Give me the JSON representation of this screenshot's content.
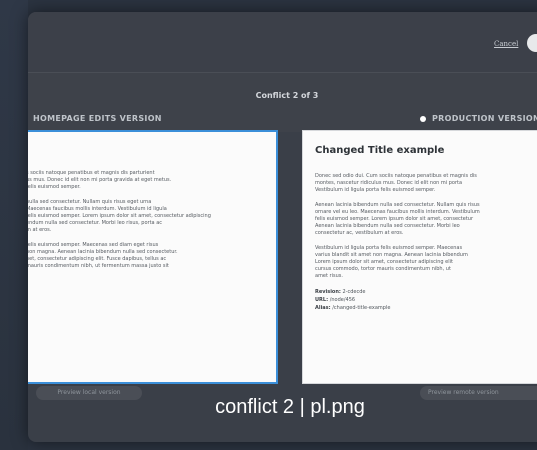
{
  "dialog": {
    "cancel_label": "Cancel",
    "conflict_count": "Conflict 2 of 3"
  },
  "left_version": {
    "title": "HOMEPAGE EDITS VERSION",
    "paragraphs": [
      "s sociis natoque penatibus et magnis dis parturient\nus mus. Donec id elit non mi porta gravida at eget metus.\nfelis euismod semper.",
      "nulla sed consectetur. Nullam quis risus eget urna\nMaecenas faucibus mollis interdum. Vestibulum id ligula\nfelis euismod semper. Lorem ipsum dolor sit amet, consectetur adipiscing\nendum nulla sed consectetur. Morbi leo risus, porta ac\nm at eros.",
      "felis euismod semper. Maecenas sed diam eget risus\nnon magna. Aenean lacinia bibendum nulla sed consectetur.\nnet, consectetur adipiscing elit. Fusce dapibus, tellus ac\nmauris condimentum nibh, ut fermentum massa justo sit"
    ],
    "preview_label": "Preview local version"
  },
  "right_version": {
    "title": "PRODUCTION VERSION",
    "heading": "Changed Title example",
    "paragraphs": [
      "Donec sed odio dui. Cum sociis natoque penatibus et magnis dis\nmontes, nascetur ridiculus mus. Donec id elit non mi porta\nVestibulum id ligula porta felis euismod semper.",
      "Aenean lacinia bibendum nulla sed consectetur. Nullam quis risus\nornare vel eu leo. Maecenas faucibus mollis interdum. Vestibulum\nfelis euismod semper. Lorem ipsum dolor sit amet, consectetur\nAenean lacinia bibendum nulla sed consectetur. Morbi leo\nconsectetur ac, vestibulum at eros.",
      "Vestibulum id ligula porta felis euismod semper. Maecenas\nvarius blandit sit amet non magna. Aenean lacinia bibendum\nLorem ipsum dolor sit amet, consectetur adipiscing elit\ncursus commodo, tortor mauris condimentum nibh, ut\namet risus."
    ],
    "revision_label": "Revision:",
    "revision_value": "2-cdecde",
    "url_label": "URL:",
    "url_value": "/node/456",
    "alias_label": "Alias:",
    "alias_value": "/changed-title-example",
    "preview_label": "Preview remote version"
  },
  "caption": "conflict 2 | pl.png"
}
